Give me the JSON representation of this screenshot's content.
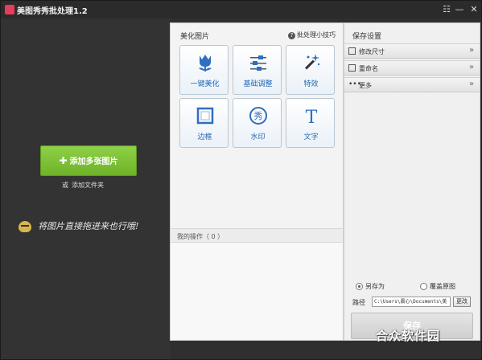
{
  "titlebar": {
    "title": "美图秀秀批处理1.2"
  },
  "left": {
    "add_button": "添加多张图片",
    "or_text": "或",
    "add_folder_link": "添加文件夹",
    "drag_hint": "将图片直接拖进来也行哦!"
  },
  "middle": {
    "title": "美化图片",
    "tips": "批处理小技巧",
    "tools": [
      {
        "label": "一键美化",
        "icon": "tulip-icon"
      },
      {
        "label": "基础调整",
        "icon": "sliders-icon"
      },
      {
        "label": "特效",
        "icon": "magic-wand-icon"
      },
      {
        "label": "边框",
        "icon": "frame-icon"
      },
      {
        "label": "水印",
        "icon": "watermark-seal-icon"
      },
      {
        "label": "文字",
        "icon": "text-t-icon"
      }
    ],
    "watermark_seal_char": "秀",
    "text_icon_char": "T",
    "ops_label": "我的操作（ 0 ）"
  },
  "right": {
    "title": "保存设置",
    "rows": [
      {
        "label": "修改尺寸",
        "icon": "crop-icon"
      },
      {
        "label": "重命名",
        "icon": "rename-icon"
      },
      {
        "label": "更多",
        "icon": "more-dots-icon"
      }
    ],
    "save_as": "另存为",
    "overwrite": "覆盖原图",
    "path_label": "路径",
    "path_value": "C:\\Users\\晨心\\Documents\\美",
    "change_button": "更改",
    "save_button": "保存"
  },
  "watermark": "合众软件园",
  "colors": {
    "accent_green": "#7dc23a",
    "tool_label_blue": "#2468b8"
  }
}
